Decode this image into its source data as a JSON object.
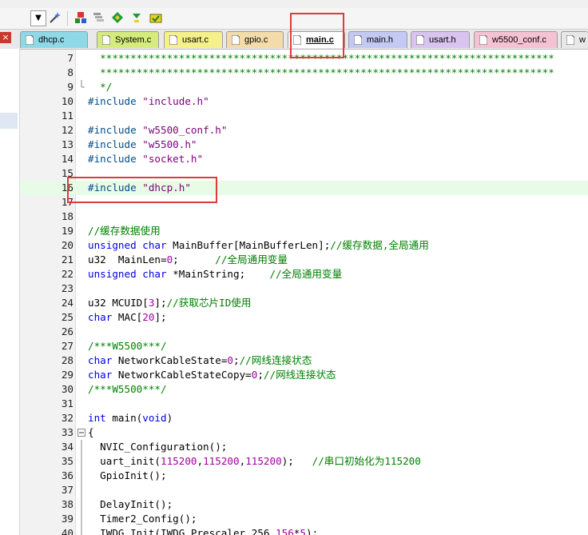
{
  "toolbar": {
    "icons": [
      "dropdown-arrow-icon",
      "wand-icon",
      "build-target-icon",
      "stack-icon",
      "diamond-icon",
      "download-icon",
      "flash-icon"
    ]
  },
  "tabs": [
    {
      "label": "dhcp.c",
      "color": "#8fd8e8"
    },
    {
      "label": "System.c",
      "color": "#d6eb7e"
    },
    {
      "label": "usart.c",
      "color": "#f5f08a"
    },
    {
      "label": "gpio.c",
      "color": "#f3dcaa"
    },
    {
      "label": "main.c",
      "color": "#ffffff",
      "active": true
    },
    {
      "label": "main.h",
      "color": "#c3c9f2"
    },
    {
      "label": "usart.h",
      "color": "#d8c4ef"
    },
    {
      "label": "w5500_conf.c",
      "color": "#f4c2d2"
    },
    {
      "label": "w",
      "color": "#e8e8e8"
    }
  ],
  "colors": {
    "keyword": "#0000e6",
    "string": "#7a0077",
    "comment": "#008000",
    "number": "#a000a0",
    "preproc": "#004c86",
    "highlight_line": "#e8fbe6",
    "annotation_box": "#e03b3b"
  },
  "code": {
    "n7": "7",
    "l7": "  ***************************************************************************",
    "n8": "8",
    "l8": "  ***************************************************************************",
    "n9": "9",
    "l9": "  */",
    "n10": "10",
    "l10a": "#include ",
    "l10b": "\"include.h\"",
    "n11": "11",
    "n12": "12",
    "l12a": "#include ",
    "l12b": "\"w5500_conf.h\"",
    "n13": "13",
    "l13a": "#include ",
    "l13b": "\"w5500.h\"",
    "n14": "14",
    "l14a": "#include ",
    "l14b": "\"socket.h\"",
    "n15": "15",
    "n16": "16",
    "l16a": "#include ",
    "l16b": "\"dhcp.h\"",
    "n17": "17",
    "n18": "18",
    "n19": "19",
    "l19": "//缓存数据使用",
    "n20": "20",
    "l20a": "unsigned char",
    "l20b": " MainBuffer[MainBufferLen];",
    "l20c": "//缓存数据,全局通用",
    "n21": "21",
    "l21a": "u32  MainLen=",
    "l21b": "0",
    "l21c": ";      ",
    "l21d": "//全局通用变量",
    "n22": "22",
    "l22a": "unsigned char",
    "l22b": " *MainString;    ",
    "l22c": "//全局通用变量",
    "n23": "23",
    "n24": "24",
    "l24a": "u32 MCUID[",
    "l24b": "3",
    "l24c": "];",
    "l24d": "//获取芯片ID使用",
    "n25": "25",
    "l25a": "char",
    "l25b": " MAC[",
    "l25c": "20",
    "l25d": "];",
    "n26": "26",
    "n27": "27",
    "l27": "/***W5500***/",
    "n28": "28",
    "l28a": "char",
    "l28b": " NetworkCableState=",
    "l28c": "0",
    "l28d": ";",
    "l28e": "//网线连接状态",
    "n29": "29",
    "l29a": "char",
    "l29b": " NetworkCableStateCopy=",
    "l29c": "0",
    "l29d": ";",
    "l29e": "//网线连接状态",
    "n30": "30",
    "l30": "/***W5500***/",
    "n31": "31",
    "n32": "32",
    "l32a": "int",
    "l32b": " main(",
    "l32c": "void",
    "l32d": ")",
    "n33": "33",
    "l33": "{",
    "n34": "34",
    "l34": "  NVIC_Configuration();",
    "n35": "35",
    "l35a": "  uart_init(",
    "l35b": "115200",
    "l35c": ",",
    "l35d": "115200",
    "l35e": ",",
    "l35f": "115200",
    "l35g": ");   ",
    "l35h": "//串口初始化为115200",
    "n36": "36",
    "l36": "  GpioInit();",
    "n37": "37",
    "n38": "38",
    "l38": "  DelayInit();",
    "n39": "39",
    "l39": "  Timer2_Config();",
    "n40": "40",
    "l40a": "  IWDG_Init(IWDG_Prescaler_256,",
    "l40b": "156",
    "l40c": "*",
    "l40d": "5",
    "l40e": ");"
  }
}
